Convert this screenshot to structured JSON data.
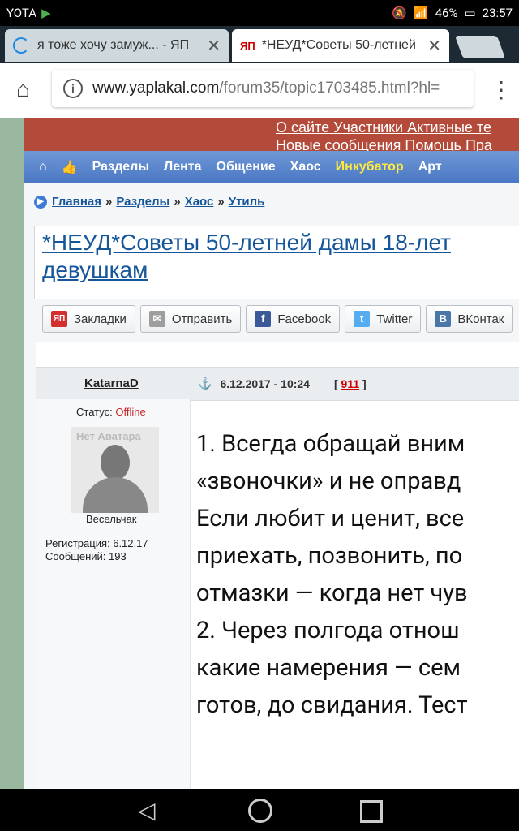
{
  "status": {
    "carrier": "YOTA",
    "battery": "46%",
    "time": "23:57"
  },
  "tabs": [
    {
      "label": "я тоже хочу замуж... - ЯП",
      "active": false
    },
    {
      "label": "*НЕУД*Советы 50-летней",
      "active": true
    }
  ],
  "omnibox": {
    "host": "www.yaplakal.com",
    "path": "/forum35/topic1703485.html?hl="
  },
  "site_links": {
    "row1": "О сайте Участники Активные те",
    "row2": "Новые сообщения Помощь Пра"
  },
  "nav": [
    "Разделы",
    "Лента",
    "Общение",
    "Хаос",
    "Инкубатор",
    "Арт"
  ],
  "breadcrumbs": [
    "Главная",
    "Разделы",
    "Хаос",
    "Утиль"
  ],
  "breadcrumb_sep": "»",
  "topic_title_line1": "*НЕУД*Советы 50-летней дамы 18-лет",
  "topic_title_line2": "девушкам",
  "share": [
    {
      "label": "Закладки",
      "icon": "yap-icon",
      "color": "#d32f2f",
      "glyph": "ЯП"
    },
    {
      "label": "Отправить",
      "icon": "mail-icon",
      "color": "#9e9e9e",
      "glyph": "✉"
    },
    {
      "label": "Facebook",
      "icon": "facebook-icon",
      "color": "#3b5998",
      "glyph": "f"
    },
    {
      "label": "Twitter",
      "icon": "twitter-icon",
      "color": "#55acee",
      "glyph": "t"
    },
    {
      "label": "ВКонтак",
      "icon": "vk-icon",
      "color": "#4a76a8",
      "glyph": "В"
    }
  ],
  "post": {
    "author": "KatarnaD",
    "date": "6.12.2017 - 10:24",
    "rating": "911",
    "status_label": "Статус:",
    "status_value": "Offline",
    "avatar_text": "Нет Аватара",
    "rank": "Весельчак",
    "reg": "Регистрация: 6.12.17",
    "msgs": "Сообщений: 193",
    "lines": [
      "1. Всегда обращай вним",
      "«звоночки» и не оправд",
      "Если любит и ценит, все",
      "приехать, позвонить, по",
      "отмазки — когда нет чув",
      "2. Через полгода отнош",
      "какие намерения — сем",
      "готов, до свидания. Тест"
    ]
  }
}
